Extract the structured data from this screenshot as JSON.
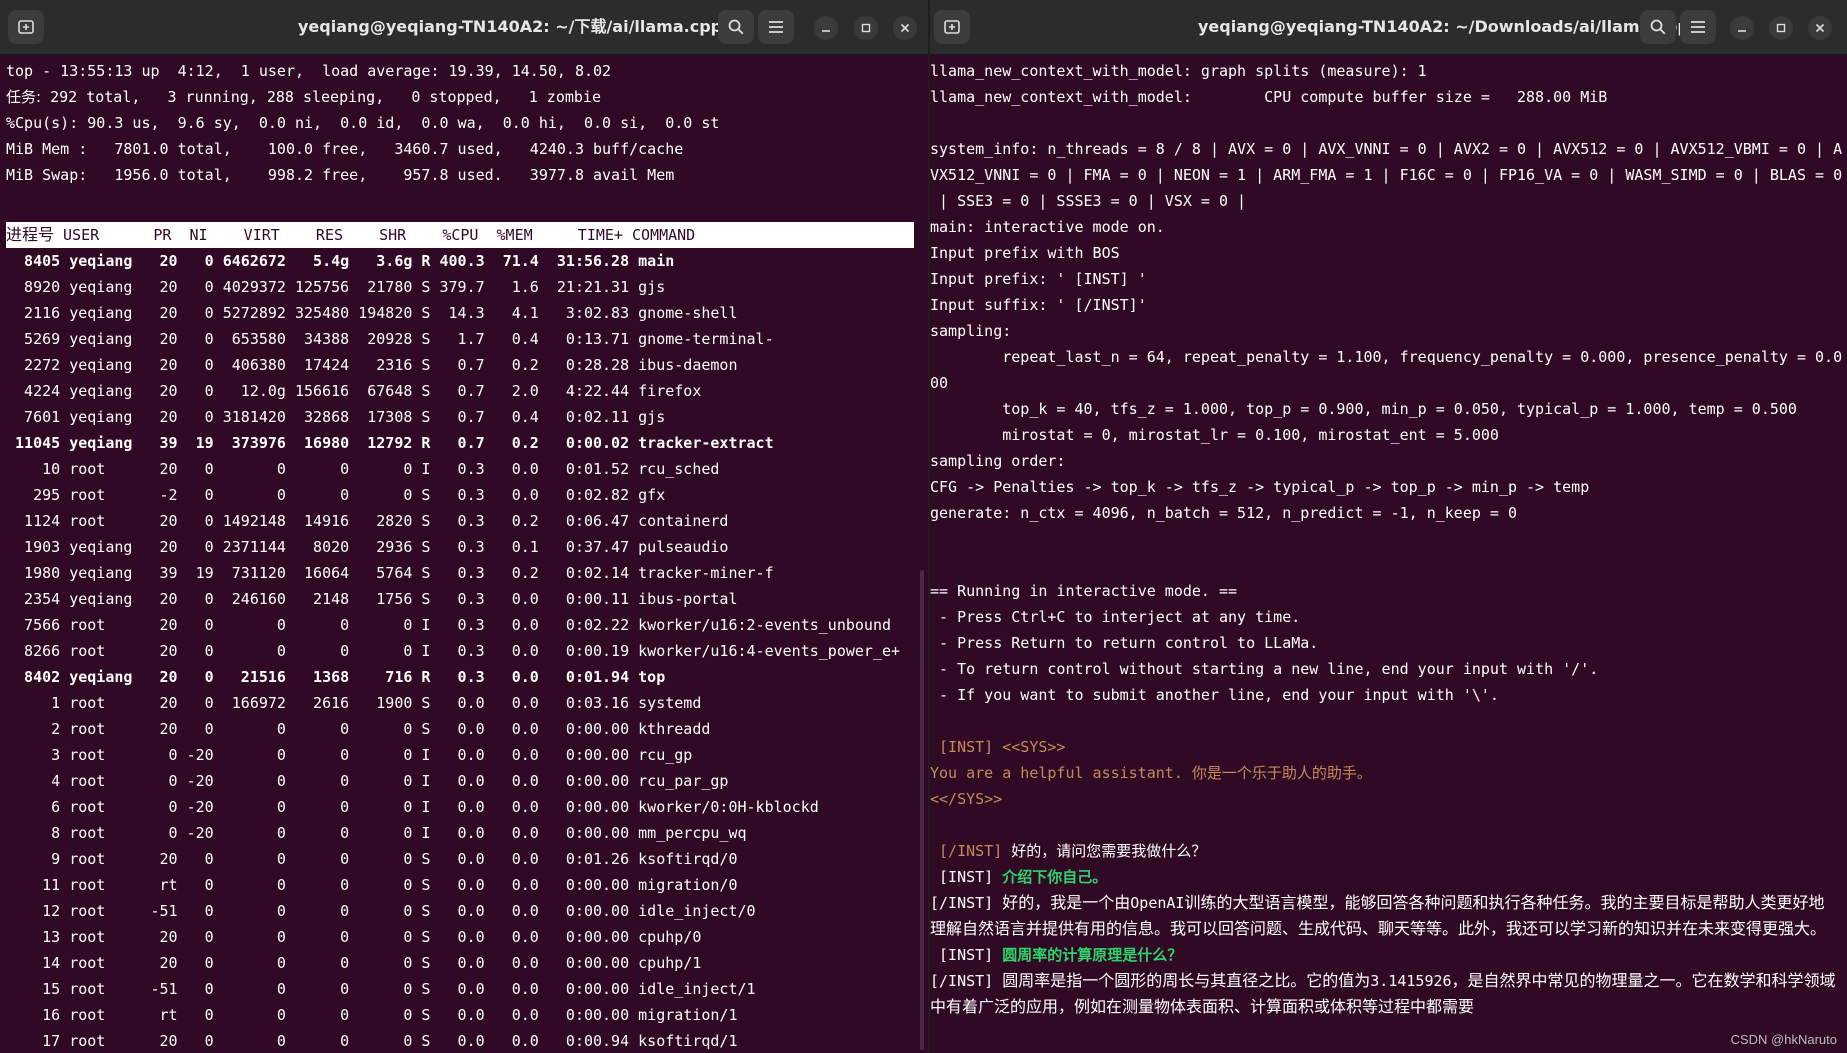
{
  "left": {
    "title": "yeqiang@yeqiang-TN140A2: ~/下载/ai/llama.cpp",
    "summary": [
      {
        "text": "top - 13:55:13 up  4:12,  1 user,  load average: 19.39, 14.50, 8.02"
      },
      {
        "label": "任务:",
        "text": " 292 total,   3 running, 288 sleeping,   0 stopped,   1 zombie"
      },
      {
        "text": "%Cpu(s): 90.3 us,  9.6 sy,  0.0 ni,  0.0 id,  0.0 wa,  0.0 hi,  0.0 si,  0.0 st"
      },
      {
        "text": "MiB Mem :   7801.0 total,    100.0 free,   3460.7 used,   4240.3 buff/cache"
      },
      {
        "text": "MiB Swap:   1956.0 total,    998.2 free,    957.8 used.   3977.8 avail Mem"
      }
    ],
    "header": {
      "pid_label": "进程号",
      "rest": " USER      PR  NI    VIRT    RES    SHR    %CPU  %MEM     TIME+ COMMAND"
    },
    "processes": [
      {
        "pid": "8405",
        "user": "yeqiang",
        "pr": "20",
        "ni": "0",
        "virt": "6462672",
        "res": "5.4g",
        "shr": "3.6g",
        "s": "R",
        "cpu": "400.3",
        "mem": "71.4",
        "time": "31:56.28",
        "cmd": "main",
        "bold": true
      },
      {
        "pid": "8920",
        "user": "yeqiang",
        "pr": "20",
        "ni": "0",
        "virt": "4029372",
        "res": "125756",
        "shr": "21780",
        "s": "S",
        "cpu": "379.7",
        "mem": "1.6",
        "time": "21:21.31",
        "cmd": "gjs"
      },
      {
        "pid": "2116",
        "user": "yeqiang",
        "pr": "20",
        "ni": "0",
        "virt": "5272892",
        "res": "325480",
        "shr": "194820",
        "s": "S",
        "cpu": "14.3",
        "mem": "4.1",
        "time": "3:02.83",
        "cmd": "gnome-shell"
      },
      {
        "pid": "5269",
        "user": "yeqiang",
        "pr": "20",
        "ni": "0",
        "virt": "653580",
        "res": "34388",
        "shr": "20928",
        "s": "S",
        "cpu": "1.7",
        "mem": "0.4",
        "time": "0:13.71",
        "cmd": "gnome-terminal-"
      },
      {
        "pid": "2272",
        "user": "yeqiang",
        "pr": "20",
        "ni": "0",
        "virt": "406380",
        "res": "17424",
        "shr": "2316",
        "s": "S",
        "cpu": "0.7",
        "mem": "0.2",
        "time": "0:28.28",
        "cmd": "ibus-daemon"
      },
      {
        "pid": "4224",
        "user": "yeqiang",
        "pr": "20",
        "ni": "0",
        "virt": "12.0g",
        "res": "156616",
        "shr": "67648",
        "s": "S",
        "cpu": "0.7",
        "mem": "2.0",
        "time": "4:22.44",
        "cmd": "firefox"
      },
      {
        "pid": "7601",
        "user": "yeqiang",
        "pr": "20",
        "ni": "0",
        "virt": "3181420",
        "res": "32868",
        "shr": "17308",
        "s": "S",
        "cpu": "0.7",
        "mem": "0.4",
        "time": "0:02.11",
        "cmd": "gjs"
      },
      {
        "pid": "11045",
        "user": "yeqiang",
        "pr": "39",
        "ni": "19",
        "virt": "373976",
        "res": "16980",
        "shr": "12792",
        "s": "R",
        "cpu": "0.7",
        "mem": "0.2",
        "time": "0:00.02",
        "cmd": "tracker-extract",
        "bold": true
      },
      {
        "pid": "10",
        "user": "root",
        "pr": "20",
        "ni": "0",
        "virt": "0",
        "res": "0",
        "shr": "0",
        "s": "I",
        "cpu": "0.3",
        "mem": "0.0",
        "time": "0:01.52",
        "cmd": "rcu_sched"
      },
      {
        "pid": "295",
        "user": "root",
        "pr": "-2",
        "ni": "0",
        "virt": "0",
        "res": "0",
        "shr": "0",
        "s": "S",
        "cpu": "0.3",
        "mem": "0.0",
        "time": "0:02.82",
        "cmd": "gfx"
      },
      {
        "pid": "1124",
        "user": "root",
        "pr": "20",
        "ni": "0",
        "virt": "1492148",
        "res": "14916",
        "shr": "2820",
        "s": "S",
        "cpu": "0.3",
        "mem": "0.2",
        "time": "0:06.47",
        "cmd": "containerd"
      },
      {
        "pid": "1903",
        "user": "yeqiang",
        "pr": "20",
        "ni": "0",
        "virt": "2371144",
        "res": "8020",
        "shr": "2936",
        "s": "S",
        "cpu": "0.3",
        "mem": "0.1",
        "time": "0:37.47",
        "cmd": "pulseaudio"
      },
      {
        "pid": "1980",
        "user": "yeqiang",
        "pr": "39",
        "ni": "19",
        "virt": "731120",
        "res": "16064",
        "shr": "5764",
        "s": "S",
        "cpu": "0.3",
        "mem": "0.2",
        "time": "0:02.14",
        "cmd": "tracker-miner-f"
      },
      {
        "pid": "2354",
        "user": "yeqiang",
        "pr": "20",
        "ni": "0",
        "virt": "246160",
        "res": "2148",
        "shr": "1756",
        "s": "S",
        "cpu": "0.3",
        "mem": "0.0",
        "time": "0:00.11",
        "cmd": "ibus-portal"
      },
      {
        "pid": "7566",
        "user": "root",
        "pr": "20",
        "ni": "0",
        "virt": "0",
        "res": "0",
        "shr": "0",
        "s": "I",
        "cpu": "0.3",
        "mem": "0.0",
        "time": "0:02.22",
        "cmd": "kworker/u16:2-events_unbound"
      },
      {
        "pid": "8266",
        "user": "root",
        "pr": "20",
        "ni": "0",
        "virt": "0",
        "res": "0",
        "shr": "0",
        "s": "I",
        "cpu": "0.3",
        "mem": "0.0",
        "time": "0:00.19",
        "cmd": "kworker/u16:4-events_power_e+"
      },
      {
        "pid": "8402",
        "user": "yeqiang",
        "pr": "20",
        "ni": "0",
        "virt": "21516",
        "res": "1368",
        "shr": "716",
        "s": "R",
        "cpu": "0.3",
        "mem": "0.0",
        "time": "0:01.94",
        "cmd": "top",
        "bold": true
      },
      {
        "pid": "1",
        "user": "root",
        "pr": "20",
        "ni": "0",
        "virt": "166972",
        "res": "2616",
        "shr": "1900",
        "s": "S",
        "cpu": "0.0",
        "mem": "0.0",
        "time": "0:03.16",
        "cmd": "systemd"
      },
      {
        "pid": "2",
        "user": "root",
        "pr": "20",
        "ni": "0",
        "virt": "0",
        "res": "0",
        "shr": "0",
        "s": "S",
        "cpu": "0.0",
        "mem": "0.0",
        "time": "0:00.00",
        "cmd": "kthreadd"
      },
      {
        "pid": "3",
        "user": "root",
        "pr": "0",
        "ni": "-20",
        "virt": "0",
        "res": "0",
        "shr": "0",
        "s": "I",
        "cpu": "0.0",
        "mem": "0.0",
        "time": "0:00.00",
        "cmd": "rcu_gp"
      },
      {
        "pid": "4",
        "user": "root",
        "pr": "0",
        "ni": "-20",
        "virt": "0",
        "res": "0",
        "shr": "0",
        "s": "I",
        "cpu": "0.0",
        "mem": "0.0",
        "time": "0:00.00",
        "cmd": "rcu_par_gp"
      },
      {
        "pid": "6",
        "user": "root",
        "pr": "0",
        "ni": "-20",
        "virt": "0",
        "res": "0",
        "shr": "0",
        "s": "I",
        "cpu": "0.0",
        "mem": "0.0",
        "time": "0:00.00",
        "cmd": "kworker/0:0H-kblockd"
      },
      {
        "pid": "8",
        "user": "root",
        "pr": "0",
        "ni": "-20",
        "virt": "0",
        "res": "0",
        "shr": "0",
        "s": "I",
        "cpu": "0.0",
        "mem": "0.0",
        "time": "0:00.00",
        "cmd": "mm_percpu_wq"
      },
      {
        "pid": "9",
        "user": "root",
        "pr": "20",
        "ni": "0",
        "virt": "0",
        "res": "0",
        "shr": "0",
        "s": "S",
        "cpu": "0.0",
        "mem": "0.0",
        "time": "0:01.26",
        "cmd": "ksoftirqd/0"
      },
      {
        "pid": "11",
        "user": "root",
        "pr": "rt",
        "ni": "0",
        "virt": "0",
        "res": "0",
        "shr": "0",
        "s": "S",
        "cpu": "0.0",
        "mem": "0.0",
        "time": "0:00.00",
        "cmd": "migration/0"
      },
      {
        "pid": "12",
        "user": "root",
        "pr": "-51",
        "ni": "0",
        "virt": "0",
        "res": "0",
        "shr": "0",
        "s": "S",
        "cpu": "0.0",
        "mem": "0.0",
        "time": "0:00.00",
        "cmd": "idle_inject/0"
      },
      {
        "pid": "13",
        "user": "root",
        "pr": "20",
        "ni": "0",
        "virt": "0",
        "res": "0",
        "shr": "0",
        "s": "S",
        "cpu": "0.0",
        "mem": "0.0",
        "time": "0:00.00",
        "cmd": "cpuhp/0"
      },
      {
        "pid": "14",
        "user": "root",
        "pr": "20",
        "ni": "0",
        "virt": "0",
        "res": "0",
        "shr": "0",
        "s": "S",
        "cpu": "0.0",
        "mem": "0.0",
        "time": "0:00.00",
        "cmd": "cpuhp/1"
      },
      {
        "pid": "15",
        "user": "root",
        "pr": "-51",
        "ni": "0",
        "virt": "0",
        "res": "0",
        "shr": "0",
        "s": "S",
        "cpu": "0.0",
        "mem": "0.0",
        "time": "0:00.00",
        "cmd": "idle_inject/1"
      },
      {
        "pid": "16",
        "user": "root",
        "pr": "rt",
        "ni": "0",
        "virt": "0",
        "res": "0",
        "shr": "0",
        "s": "S",
        "cpu": "0.0",
        "mem": "0.0",
        "time": "0:00.00",
        "cmd": "migration/1"
      },
      {
        "pid": "17",
        "user": "root",
        "pr": "20",
        "ni": "0",
        "virt": "0",
        "res": "0",
        "shr": "0",
        "s": "S",
        "cpu": "0.0",
        "mem": "0.0",
        "time": "0:00.94",
        "cmd": "ksoftirqd/1"
      }
    ]
  },
  "right": {
    "title": "yeqiang@yeqiang-TN140A2: ~/Downloads/ai/llama.cpp",
    "log": [
      "llama_new_context_with_model: graph splits (measure): 1",
      "llama_new_context_with_model:        CPU compute buffer size =   288.00 MiB",
      "",
      "system_info: n_threads = 8 / 8 | AVX = 0 | AVX_VNNI = 0 | AVX2 = 0 | AVX512 = 0 | AVX512_VBMI = 0 | A",
      "VX512_VNNI = 0 | FMA = 0 | NEON = 1 | ARM_FMA = 1 | F16C = 0 | FP16_VA = 0 | WASM_SIMD = 0 | BLAS = 0",
      " | SSE3 = 0 | SSSE3 = 0 | VSX = 0 |",
      "main: interactive mode on.",
      "Input prefix with BOS",
      "Input prefix: ' [INST] '",
      "Input suffix: ' [/INST]'",
      "sampling:",
      "        repeat_last_n = 64, repeat_penalty = 1.100, frequency_penalty = 0.000, presence_penalty = 0.0",
      "00",
      "        top_k = 40, tfs_z = 1.000, top_p = 0.900, min_p = 0.050, typical_p = 1.000, temp = 0.500",
      "        mirostat = 0, mirostat_lr = 0.100, mirostat_ent = 5.000",
      "sampling order:",
      "CFG -> Penalties -> top_k -> tfs_z -> typical_p -> top_p -> min_p -> temp",
      "generate: n_ctx = 4096, n_batch = 512, n_predict = -1, n_keep = 0",
      "",
      "",
      "== Running in interactive mode. ==",
      " - Press Ctrl+C to interject at any time.",
      " - Press Return to return control to LLaMa.",
      " - To return control without starting a new line, end your input with '/'.",
      " - If you want to submit another line, end your input with '\\'.",
      ""
    ],
    "sys_open": " [INST] <<SYS>>",
    "sys_text": "You are a helpful assistant. 你是一个乐于助人的助手。",
    "sys_close": "<</SYS>>",
    "inst_tag": " [INST] ",
    "end_inst_tag": " [/INST] ",
    "first_reply": "好的，请问您需要我做什么？",
    "q1": "介绍下你自己。",
    "a1_pre": "好的，我是一个由",
    "a1_mono": "OpenAI",
    "a1_post": "训练的大型语言模型，能够回答各种问题和执行各种任务。我的主要目标是帮助人类更好地理解自然语言并提供有用的信息。我可以回答问题、生成代码、聊天等等。此外，我还可以学习新的知识并在未来变得更强大。",
    "q2": "圆周率的计算原理是什么？",
    "a2_pre": "圆周率是指一个圆形的周长与其直径之比。它的值为",
    "a2_mono": "3.1415926",
    "a2_post": "，是自然界中常见的物理量之一。它在数学和科学领域中有着广泛的应用，例如在测量物体表面积、计算面积或体积等过程中都需要"
  },
  "watermark": "CSDN @hkNaruto",
  "icons": {
    "new_tab": "new-tab-icon",
    "search": "search-icon",
    "menu": "hamburger-menu-icon",
    "minimize": "minimize-icon",
    "maximize": "maximize-icon",
    "close": "close-icon"
  },
  "colors": {
    "terminal_bg": "#300a24",
    "titlebar_bg": "#2c2c2c",
    "user_prompt_green": "#2fd36b",
    "tag_orange": "#c48b5a"
  }
}
